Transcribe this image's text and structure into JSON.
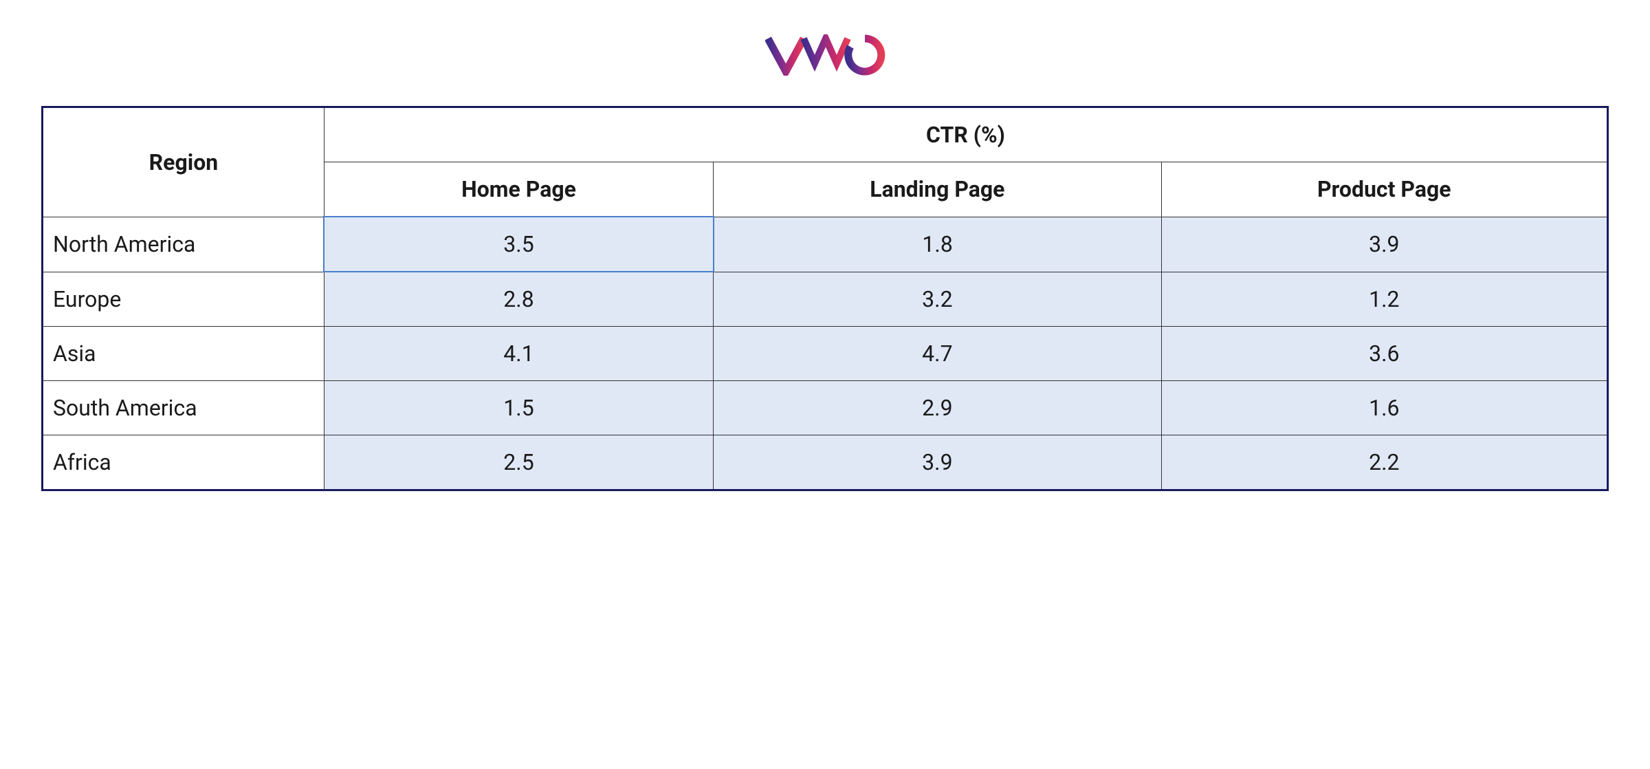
{
  "logo": "VWO",
  "table": {
    "region_header": "Region",
    "group_header": "CTR (%)",
    "columns": [
      "Home Page",
      "Landing Page",
      "Product Page"
    ],
    "rows": [
      {
        "region": "North America",
        "values": [
          "3.5",
          "1.8",
          "3.9"
        ],
        "highlight": 0
      },
      {
        "region": "Europe",
        "values": [
          "2.8",
          "3.2",
          "1.2"
        ]
      },
      {
        "region": "Asia",
        "values": [
          "4.1",
          "4.7",
          "3.6"
        ]
      },
      {
        "region": "South America",
        "values": [
          "1.5",
          "2.9",
          "1.6"
        ]
      },
      {
        "region": "Africa",
        "values": [
          "2.5",
          "3.9",
          "2.2"
        ]
      }
    ]
  },
  "chart_data": {
    "type": "table",
    "title": "CTR (%)",
    "categories": [
      "North America",
      "Europe",
      "Asia",
      "South America",
      "Africa"
    ],
    "series": [
      {
        "name": "Home Page",
        "values": [
          3.5,
          2.8,
          4.1,
          1.5,
          2.5
        ]
      },
      {
        "name": "Landing Page",
        "values": [
          1.8,
          3.2,
          4.7,
          2.9,
          3.9
        ]
      },
      {
        "name": "Product Page",
        "values": [
          3.9,
          1.2,
          3.6,
          1.6,
          2.2
        ]
      }
    ]
  }
}
